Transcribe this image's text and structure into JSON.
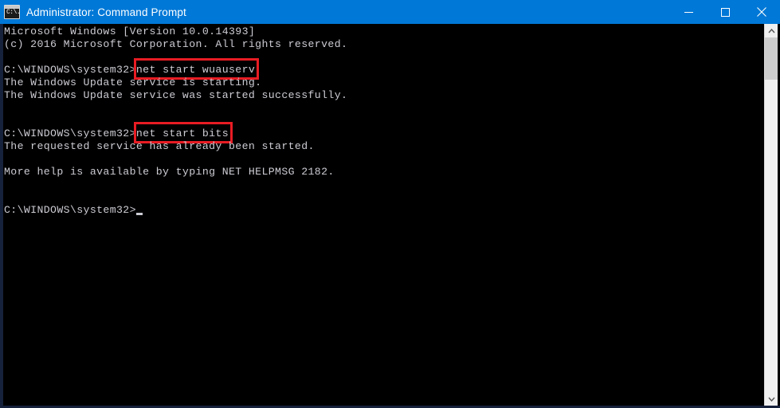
{
  "window": {
    "title": "Administrator: Command Prompt",
    "icon": "cmd-console-icon",
    "icon_text": "C:\\.",
    "titlebar_color": "#0078d7",
    "controls": [
      {
        "name": "minimize",
        "glyph": "minimize-icon"
      },
      {
        "name": "maximize",
        "glyph": "maximize-icon"
      },
      {
        "name": "close",
        "glyph": "close-icon"
      }
    ]
  },
  "console": {
    "background": "#000000",
    "text_color": "#ccccd4",
    "lines": [
      {
        "text": "Microsoft Windows [Version 10.0.14393]"
      },
      {
        "text": "(c) 2016 Microsoft Corporation. All rights reserved."
      },
      {
        "text": ""
      },
      {
        "prompt": "C:\\WINDOWS\\system32>",
        "command": "net start wuauserv",
        "highlight": true
      },
      {
        "text": "The Windows Update service is starting."
      },
      {
        "text": "The Windows Update service was started successfully."
      },
      {
        "text": ""
      },
      {
        "text": ""
      },
      {
        "prompt": "C:\\WINDOWS\\system32>",
        "command": "net start bits",
        "highlight": true
      },
      {
        "text": "The requested service has already been started."
      },
      {
        "text": ""
      },
      {
        "text": "More help is available by typing NET HELPMSG 2182."
      },
      {
        "text": ""
      },
      {
        "text": ""
      },
      {
        "prompt": "C:\\WINDOWS\\system32>",
        "command": "",
        "cursor": true
      }
    ]
  },
  "annotations": {
    "highlight_color": "#e81c23",
    "boxes": [
      {
        "target": "net start wuauserv"
      },
      {
        "target": "net start bits"
      }
    ]
  },
  "scrollbar": {
    "up_arrow": "chevron-up-icon",
    "down_arrow": "chevron-down-icon",
    "track_color": "#f0f0f0",
    "thumb_color": "#cdcdcd"
  }
}
